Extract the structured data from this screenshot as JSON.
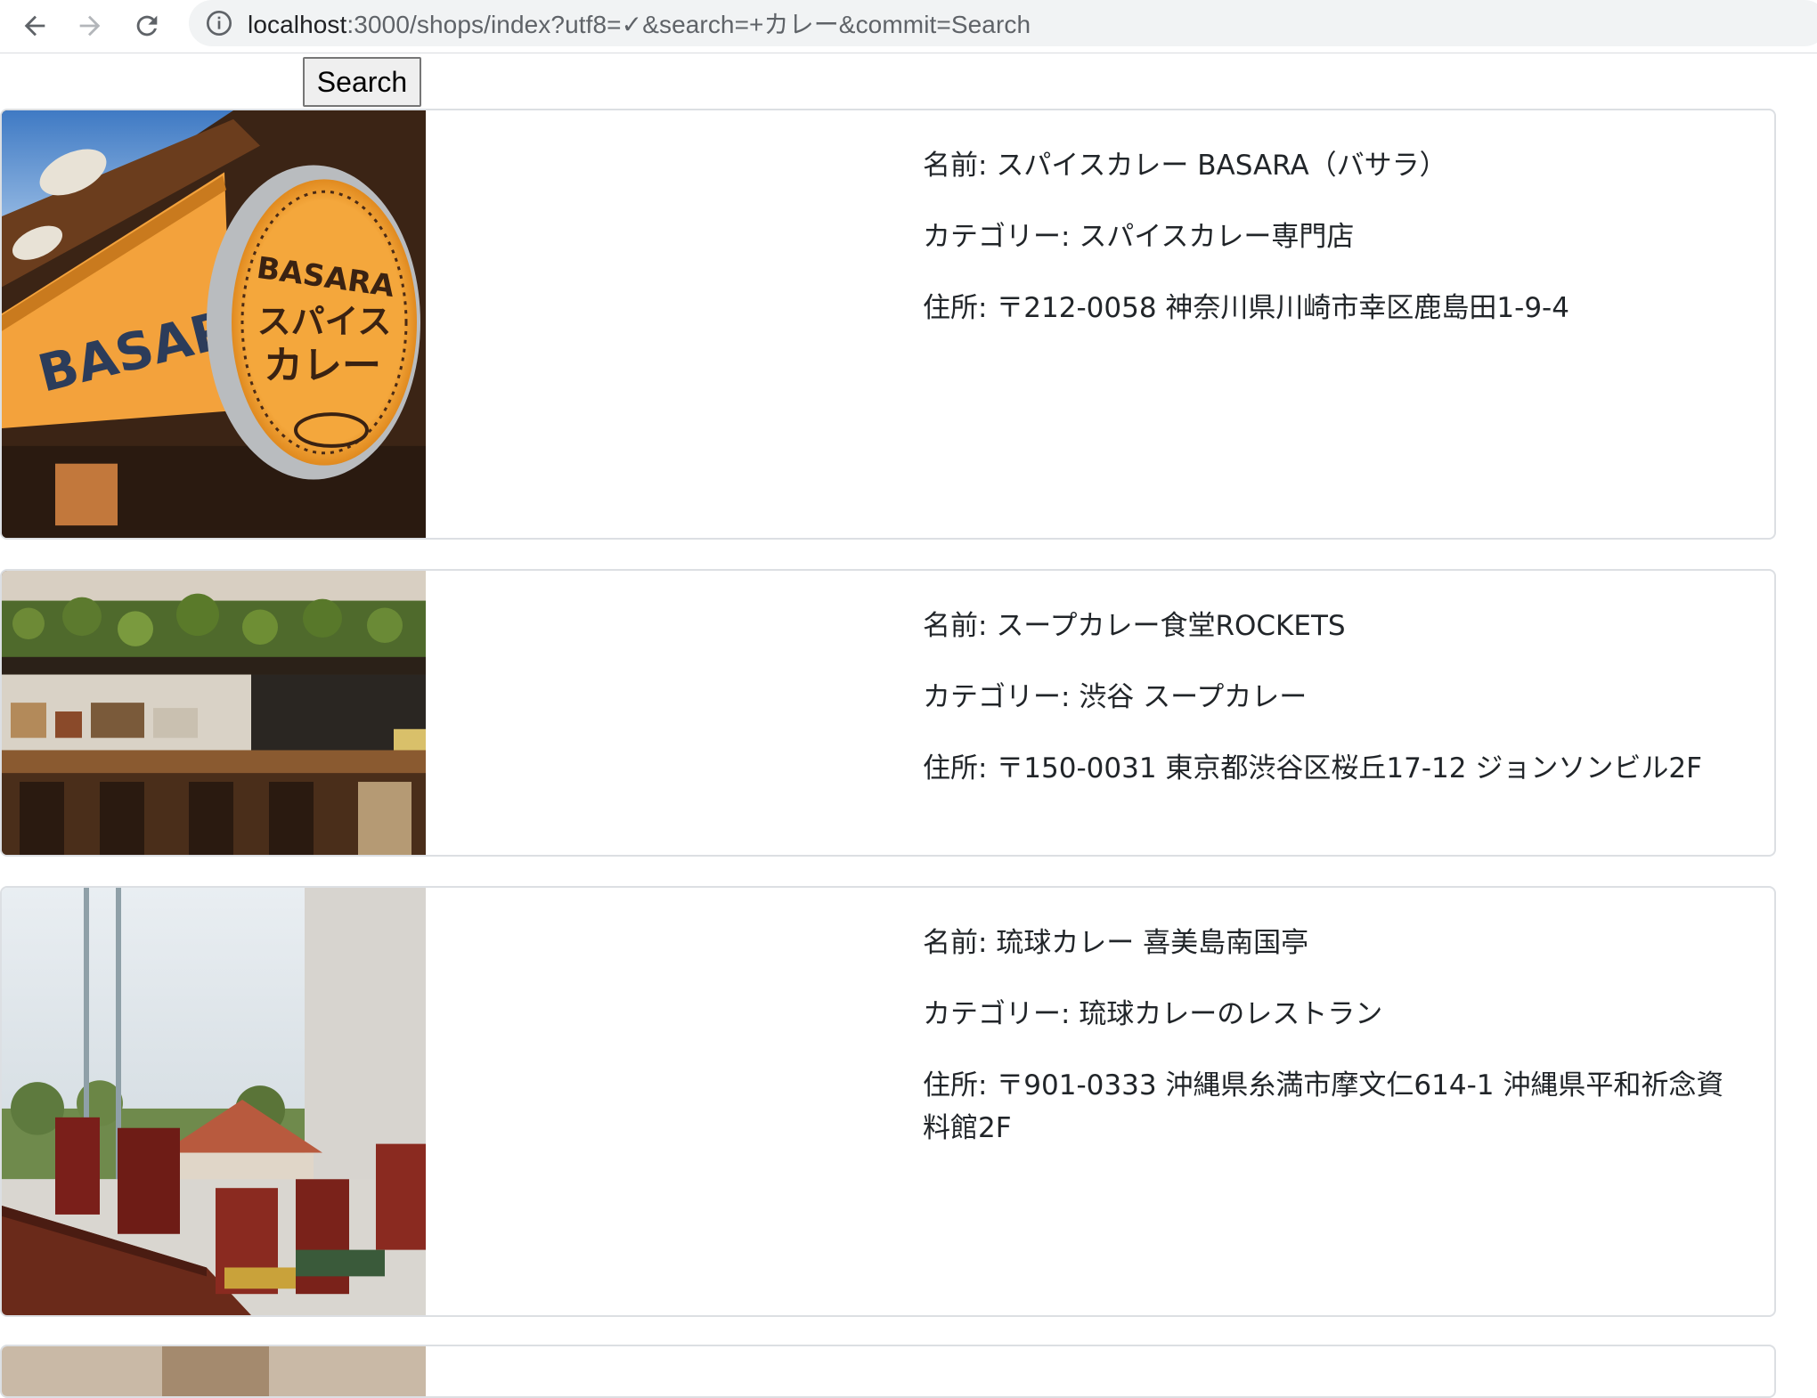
{
  "browser": {
    "url_host": "localhost",
    "url_rest": ":3000/shops/index?utf8=✓&search=+カレー&commit=Search"
  },
  "search": {
    "value": "",
    "button_label": "Search"
  },
  "shops": [
    {
      "name_label": "名前: ",
      "name": "スパイスカレー BASARA（バサラ）",
      "category_label": "カテゴリー: ",
      "category": "スパイスカレー専門店",
      "address_label": "住所: ",
      "address": "〒212-0058 神奈川県川崎市幸区鹿島田1-9-4",
      "sign_text": "BASARA",
      "sign_text2": "スパイス",
      "sign_text3": "カレー"
    },
    {
      "name_label": "名前: ",
      "name": "スープカレー食堂ROCKETS",
      "category_label": "カテゴリー: ",
      "category": "渋谷 スープカレー",
      "address_label": "住所: ",
      "address": "〒150-0031 東京都渋谷区桜丘17-12 ジョンソンビル2F"
    },
    {
      "name_label": "名前: ",
      "name": "琉球カレー 喜美島南国亭",
      "category_label": "カテゴリー: ",
      "category": "琉球カレーのレストラン",
      "address_label": "住所: ",
      "address": "〒901-0333 沖縄県糸満市摩文仁614-1 沖縄県平和祈念資料館2F"
    }
  ]
}
